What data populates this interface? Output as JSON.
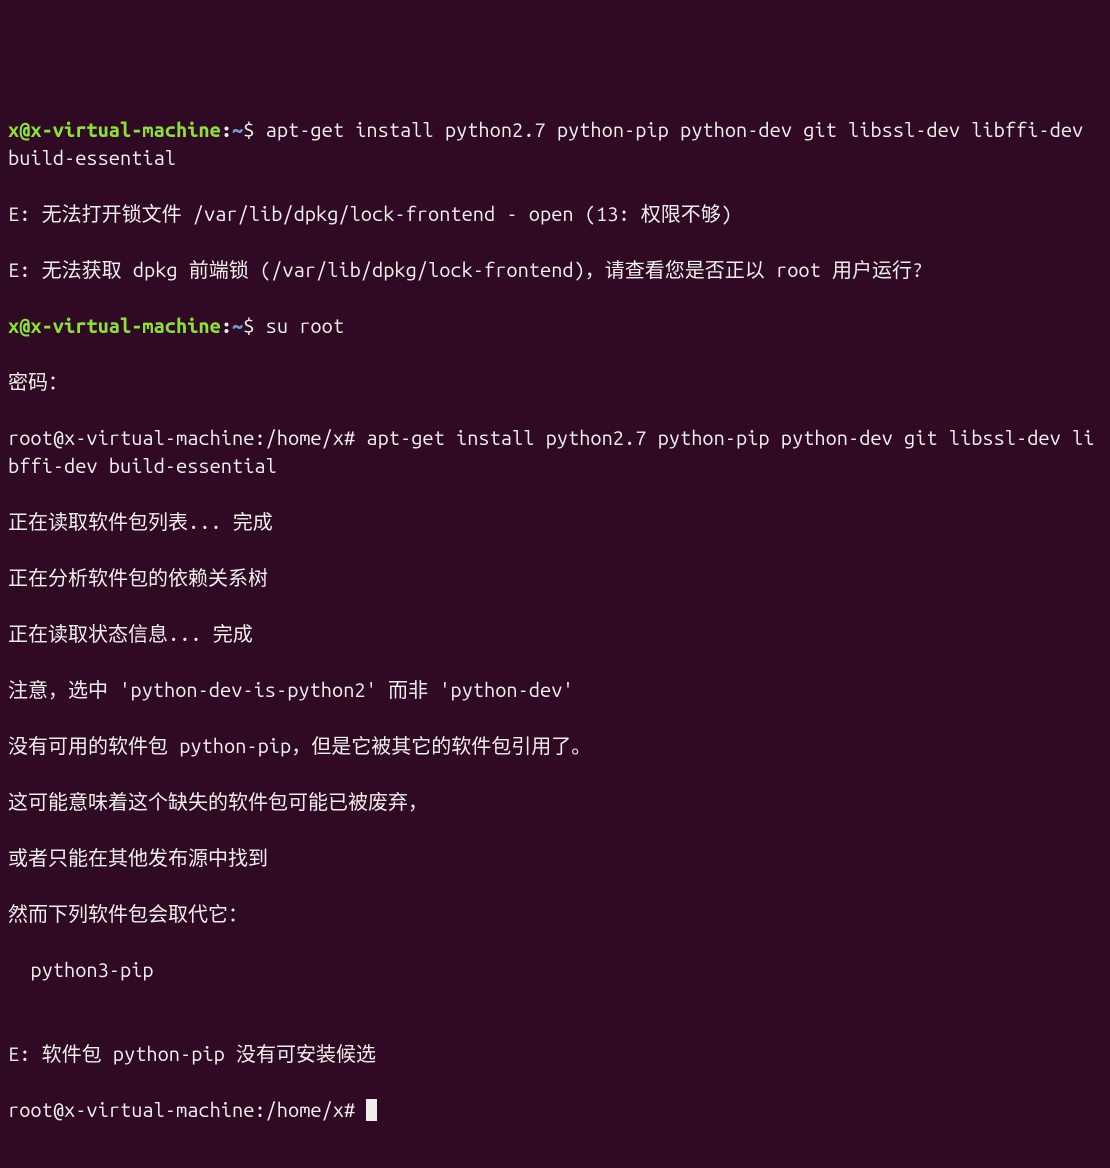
{
  "prompt1": {
    "user": "x",
    "at": "@",
    "host": "x-virtual-machine",
    "colon": ":",
    "path": "~",
    "dollar": "$ "
  },
  "cmd1": "apt-get install python2.7 python-pip python-dev git libssl-dev libffi-dev build-essential",
  "output1_line1": "E: 无法打开锁文件 /var/lib/dpkg/lock-frontend - open (13: 权限不够)",
  "output1_line2": "E: 无法获取 dpkg 前端锁 (/var/lib/dpkg/lock-frontend)，请查看您是否正以 root 用户运行?",
  "prompt2": {
    "user": "x",
    "at": "@",
    "host": "x-virtual-machine",
    "colon": ":",
    "path": "~",
    "dollar": "$ "
  },
  "cmd2": "su root",
  "output2_line1": "密码：",
  "root_prompt1": "root@x-virtual-machine:/home/x# ",
  "cmd3": "apt-get install python2.7 python-pip python-dev git libssl-dev libffi-dev build-essential",
  "output3_line1": "正在读取软件包列表... 完成",
  "output3_line2": "正在分析软件包的依赖关系树",
  "output3_line3": "正在读取状态信息... 完成",
  "output3_line4": "注意，选中 'python-dev-is-python2' 而非 'python-dev'",
  "output3_line5": "没有可用的软件包 python-pip，但是它被其它的软件包引用了。",
  "output3_line6": "这可能意味着这个缺失的软件包可能已被废弃，",
  "output3_line7": "或者只能在其他发布源中找到",
  "output3_line8": "然而下列软件包会取代它：",
  "output3_line9": "  python3-pip",
  "output3_blank": "",
  "output3_line10": "E: 软件包 python-pip 没有可安装候选",
  "root_prompt2": "root@x-virtual-machine:/home/x# "
}
